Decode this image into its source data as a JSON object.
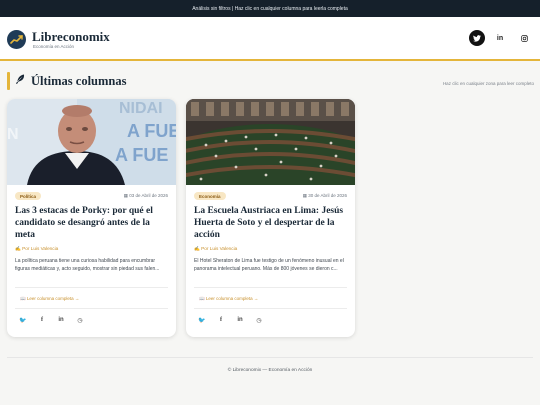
{
  "topbar": {
    "text": "Análisis sin filtros | Haz clic en cualquier columna para leerla completa"
  },
  "header": {
    "brand": "Libreconomix",
    "tagline": "Economía en Acción",
    "social": [
      {
        "icon": "twitter-icon",
        "glyph": "🐦"
      },
      {
        "icon": "linkedin-icon",
        "glyph": "in"
      },
      {
        "icon": "instagram-icon",
        "glyph": "◎"
      }
    ]
  },
  "section": {
    "icon": "feather-icon",
    "title": "Últimas columnas",
    "hint": "Haz clic en cualquier zona para leer completo"
  },
  "cards": [
    {
      "category": "Política",
      "date": "03 de Abril de 2026",
      "title": "Las 3 estacas de Porky: por qué el candidato se desangró antes de la meta",
      "author": "✍ Por Luis Valencia",
      "excerpt": "La política peruana tiene una curiosa habilidad para encumbrar figuras mediáticas y, acto seguido, mostrar sin piedad sus falen...",
      "read_more": "📖 Leer columna completa →",
      "image_text": "UNIDAD ... FUE ... FUE"
    },
    {
      "category": "Economía",
      "date": "30 de Abril de 2026",
      "title": "La Escuela Austriaca en Lima: Jesús Huerta de Soto y el despertar de la acción",
      "author": "✍ Por Luis Valencia",
      "excerpt": "El Hotel Sheraton de Lima fue testigo de un fenómeno inusual en el panorama intelectual peruano. Más de 800 jóvenes se dieron c...",
      "read_more": "📖 Leer columna completa →"
    }
  ],
  "share_icons": [
    "twitter-icon",
    "facebook-icon",
    "linkedin-icon",
    "whatsapp-icon"
  ],
  "footer": {
    "text": "© Libreconomix — Economía en Acción"
  },
  "colors": {
    "accent": "#e4b53a",
    "dark": "#15202b",
    "brand": "#1b2a38"
  }
}
